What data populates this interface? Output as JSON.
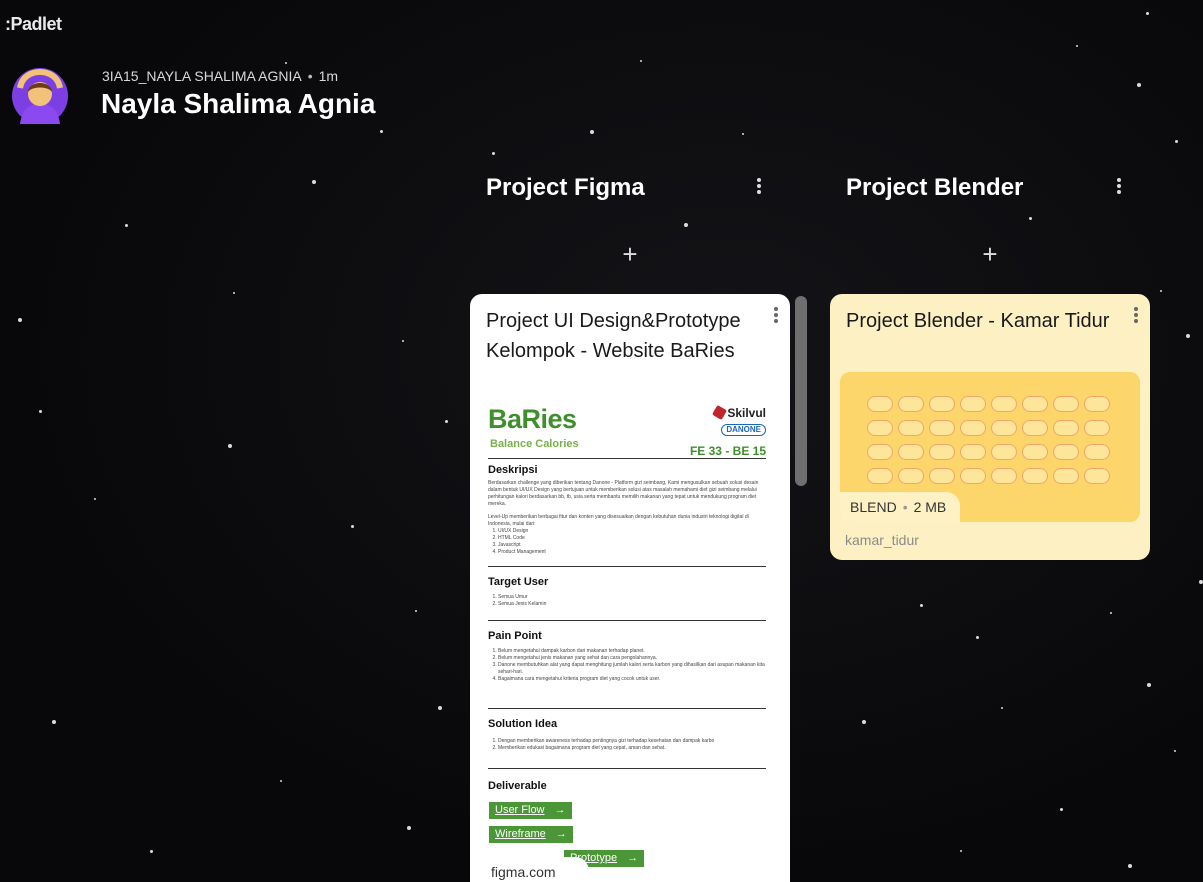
{
  "app": {
    "logo": ":Padlet"
  },
  "header": {
    "owner": "3IA15_NAYLA SHALIMA AGNIA",
    "separator": "•",
    "age": "1m",
    "title": "Nayla Shalima Agnia"
  },
  "columns": [
    {
      "title": "Project Figma",
      "add_label": "+",
      "cards": [
        {
          "title": "Project UI Design&Prototype Kelompok - Website BaRies",
          "source": "figma.com",
          "preview": {
            "brand": "BaRies",
            "brand_sub": "Balance Calories",
            "sponsor_1": "Skilvul",
            "sponsor_2": "DANONE",
            "code": "FE 33 - BE 15",
            "sections": {
              "deskripsi_title": "Deskripsi",
              "deskripsi_text_1": "Berdasarkan challenge yang diberikan tentang Danone - Platform gizi seimbang, Kami mengusulkan sebuah solusi desain dalam bentuk UI/UX Design yang bertujuan untuk memberikan solusi atas masalah memahami diet gizi seimbang melalui perhitungan kalori berdasarkan bb, tb, usia serta membantu memilih makanan yang tepat untuk mendukung program diet mereka.",
              "deskripsi_text_2": "Level-Up memberikan berbagai fitur dan konten yang disesuaikan dengan kebutuhan dunia industri teknologi digital di Indonesia, mulai dari:",
              "deskripsi_list": [
                "UI/UX Design",
                "HTML Code",
                "Javascript",
                "Product Management"
              ],
              "target_title": "Target User",
              "target_list": [
                "Semua Umur",
                "Semua Jenis Kelamin"
              ],
              "pain_title": "Pain Point",
              "pain_list": [
                "Belum mengetahui dampak karbon dari makanan terhadap planet.",
                "Belum mengetahui jenis makanan yang sehat dan cara pengolahannya.",
                "Danone membutuhkan alat yang dapat menghitung jumlah kalori serta karbon yang dihasilkan dari asupan makanan kita sehari-hari.",
                "Bagaimana cara mengetahui kriteria program diet yang cocok untuk user."
              ],
              "solution_title": "Solution Idea",
              "solution_list": [
                "Dengan memberikan awareness terhadap pentingnya gizi terhadap kesehatan dan dampak karbo",
                "Memberikan edukasi bagaimana program diet yang cepat, aman dan sehat."
              ],
              "deliverable_title": "Deliverable",
              "deliverables": [
                "User Flow",
                "Wireframe",
                "Prototype"
              ],
              "arrow": "→"
            }
          }
        }
      ]
    },
    {
      "title": "Project Blender",
      "add_label": "+",
      "cards": [
        {
          "title": "Project Blender - Kamar Tidur",
          "file_type": "BLEND",
          "file_size": "2 MB",
          "separator": "•",
          "caption": "kamar_tidur"
        }
      ]
    }
  ],
  "colors": {
    "background": "#0b0b0d",
    "figma_card": "#ffffff",
    "blender_card": "#fdf1c4",
    "attachment": "#fcd66a",
    "brand_green": "#3f8f2c"
  }
}
